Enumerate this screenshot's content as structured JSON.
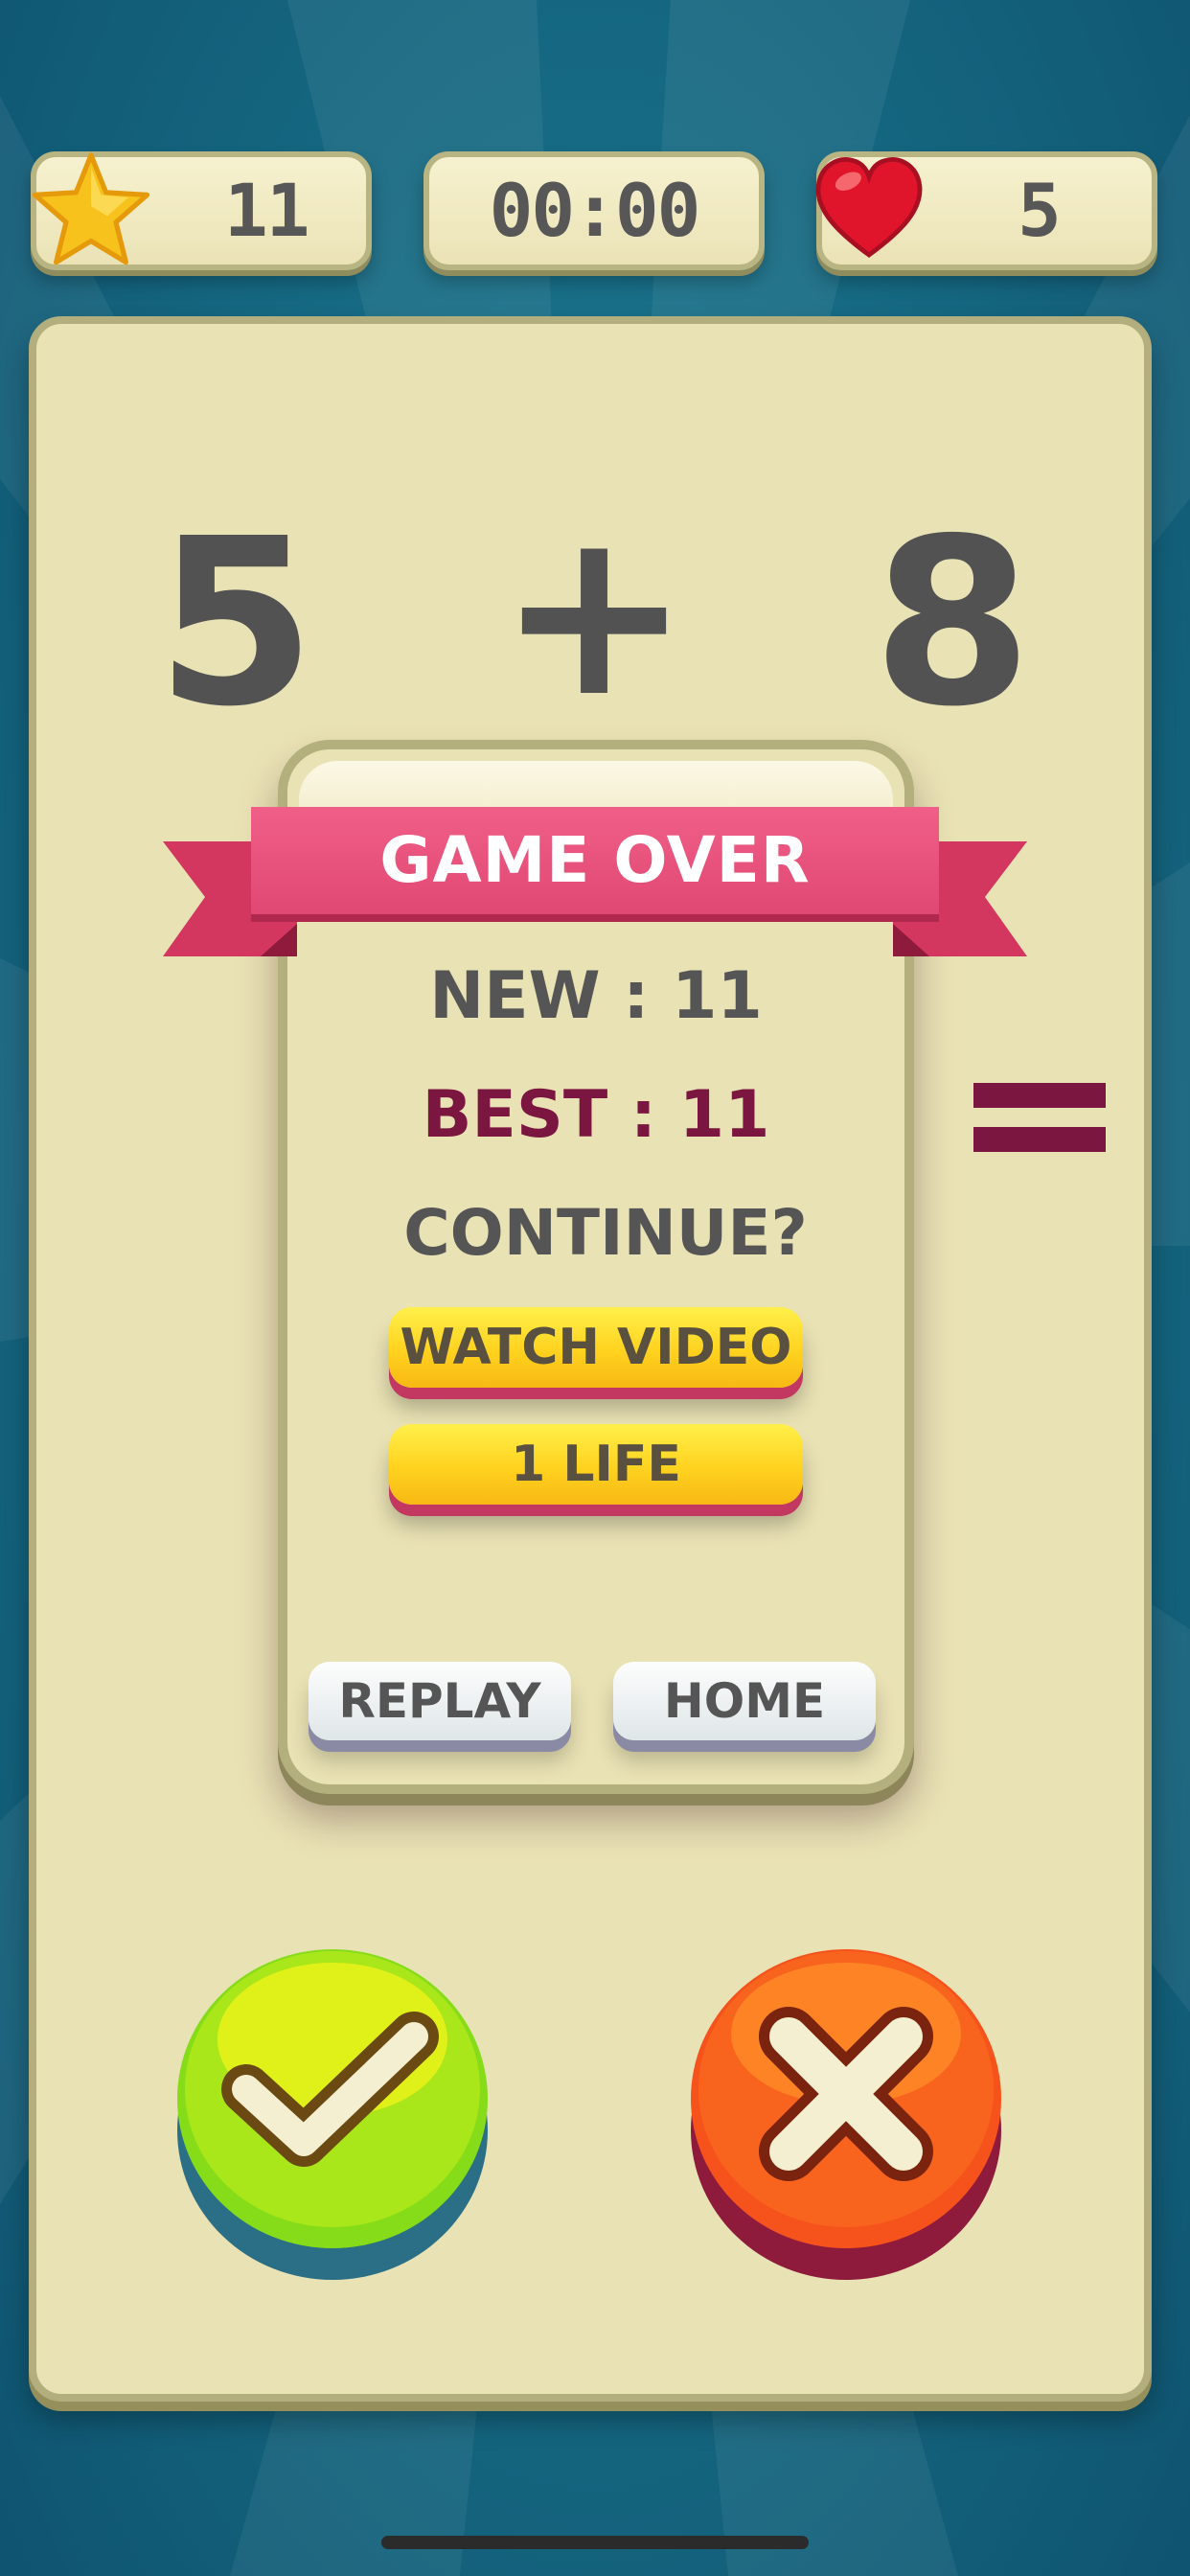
{
  "hud": {
    "stars": "11",
    "timer": "00:00",
    "lives": "5"
  },
  "equation": {
    "left": "5",
    "operator": "+",
    "right": "8"
  },
  "dialog": {
    "title": "GAME OVER",
    "new_score": "NEW : 11",
    "best_score": "BEST : 11",
    "continue_prompt": "CONTINUE?",
    "watch_video_label": "WATCH VIDEO",
    "one_life_label": "1 LIFE",
    "replay_label": "REPLAY",
    "home_label": "HOME"
  },
  "icons": {
    "hud_left": "star-icon",
    "hud_right": "heart-icon",
    "answer_true": "check-icon",
    "answer_false": "cross-icon"
  },
  "colors": {
    "ribbon": "#e84a78",
    "best_score": "#7a1640",
    "correct_button": "#8ee01a",
    "wrong_button": "#f6541b",
    "panel": "#e9e2b4",
    "background": "#176d86"
  }
}
